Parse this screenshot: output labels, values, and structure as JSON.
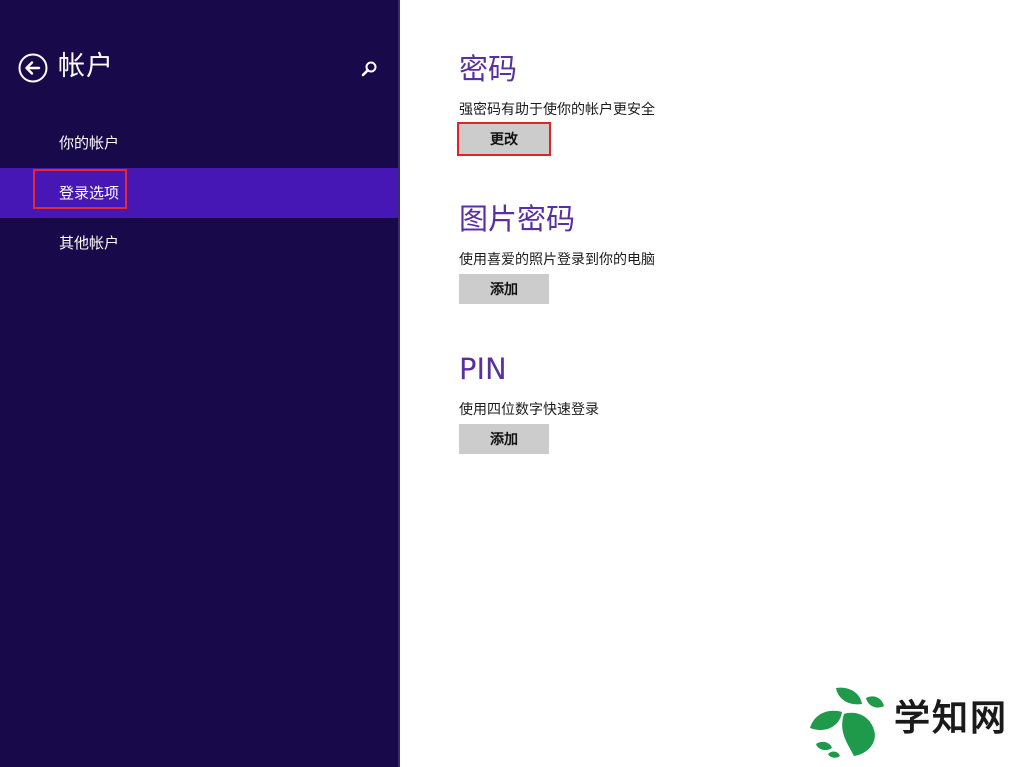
{
  "sidebar": {
    "title": "帐户",
    "back_icon": "back-arrow-circle-icon",
    "search_icon": "search-icon",
    "items": [
      {
        "label": "你的帐户",
        "selected": false
      },
      {
        "label": "登录选项",
        "selected": true
      },
      {
        "label": "其他帐户",
        "selected": false
      }
    ]
  },
  "main": {
    "sections": [
      {
        "heading": "密码",
        "description": "强密码有助于使你的帐户更安全",
        "button_label": "更改"
      },
      {
        "heading": "图片密码",
        "description": "使用喜爱的照片登录到你的电脑",
        "button_label": "添加"
      },
      {
        "heading": "PIN",
        "description": "使用四位数字快速登录",
        "button_label": "添加"
      }
    ]
  },
  "watermark": {
    "text": "学知网",
    "icon": "leaf-logo-icon"
  },
  "colors": {
    "sidebar_bg": "#180a4a",
    "selected_bg": "#4617b4",
    "heading": "#5a2fa0",
    "button_bg": "#cccccc",
    "highlight_red": "#e0252a"
  }
}
